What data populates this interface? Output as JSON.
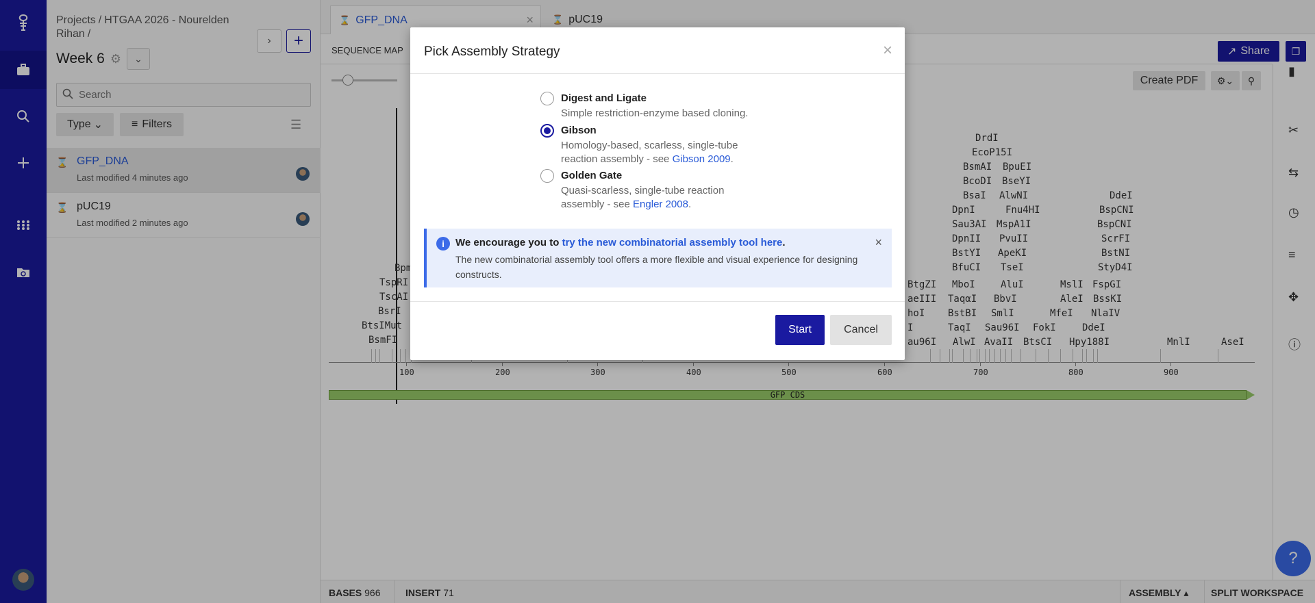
{
  "nav": {
    "items": [
      {
        "icon": "logo-icon"
      },
      {
        "icon": "briefcase-icon"
      },
      {
        "icon": "search-icon"
      },
      {
        "icon": "plus-icon"
      },
      {
        "icon": "apps-grid-icon"
      },
      {
        "icon": "folder-sync-icon"
      }
    ]
  },
  "sidebar": {
    "breadcrumb": [
      "Projects",
      "HTGAA 2026 - Nourelden Rihan"
    ],
    "folder_title": "Week 6",
    "search_placeholder": "Search",
    "type_label": "Type",
    "filters_label": "Filters",
    "items": [
      {
        "name": "GFP_DNA",
        "modified": "Last modified 4 minutes ago"
      },
      {
        "name": "pUC19",
        "modified": "Last modified 2 minutes ago"
      }
    ]
  },
  "tabs": [
    {
      "label": "GFP_DNA"
    },
    {
      "label": "pUC19"
    }
  ],
  "main": {
    "view_label": "SEQUENCE MAP",
    "share_label": "Share",
    "create_pdf_label": "Create PDF",
    "feature_label": "GFP CDS",
    "ticks": [
      "100",
      "200",
      "300",
      "400",
      "500",
      "600",
      "700",
      "800",
      "900"
    ],
    "enzymes_left": [
      "Bpm",
      "TspRI",
      "TscAI",
      "BsrI",
      "BtsIMut",
      "BsmFI"
    ],
    "enzymes_mid1": [
      "BtgZI",
      "aeIII",
      "hoI",
      "I",
      "au96I"
    ],
    "enzymes_mid2": [
      "DrdI",
      "EcoP15I",
      "BsmAI",
      "BcoDI",
      "BsaI",
      "DpnI",
      "Sau3AI",
      "DpnII",
      "BstYI",
      "BfuCI",
      "MboI",
      "TaqαI",
      "BstBI",
      "TaqI",
      "AlwI"
    ],
    "enzymes_mid3": [
      "BpuEI",
      "BseYI",
      "AlwNI",
      "Fnu4HI",
      "MspA1I",
      "PvuII",
      "ApeKI",
      "TseI",
      "AluI",
      "BbvI",
      "SmlI",
      "Sau96I",
      "AvaII",
      "FokI",
      "BtsCI"
    ],
    "enzymes_right": [
      "DdeI",
      "BspCNI",
      "BspCNI",
      "ScrFI",
      "BstNI",
      "StyD4I",
      "MslI",
      "FspGI",
      "AleI",
      "BssKI",
      "MfeI",
      "NlaIV",
      "DdeI",
      "Hpy188I",
      "MnlI",
      "AseI"
    ]
  },
  "status": {
    "bases_label": "BASES",
    "bases_value": "966",
    "insert_label": "INSERT",
    "insert_value": "71",
    "assembly_label": "ASSEMBLY",
    "split_label": "SPLIT WORKSPACE"
  },
  "modal": {
    "title": "Pick Assembly Strategy",
    "options": [
      {
        "label": "Digest and Ligate",
        "desc": "Simple restriction-enzyme based cloning.",
        "selected": false
      },
      {
        "label": "Gibson",
        "desc": "Homology-based, scarless, single-tube reaction assembly - see ",
        "link": "Gibson 2009",
        "selected": true
      },
      {
        "label": "Golden Gate",
        "desc": "Quasi-scarless, single-tube reaction assembly - see ",
        "link": "Engler 2008",
        "selected": false
      }
    ],
    "banner_prefix": "We encourage you to ",
    "banner_link": "try the new combinatorial assembly tool here",
    "banner_body": "The new combinatorial assembly tool offers a more flexible and visual experience for designing constructs.",
    "start_label": "Start",
    "cancel_label": "Cancel"
  },
  "colors": {
    "brand": "#1a1aa0",
    "link": "#2a5bd7",
    "feature": "#9acd6a"
  }
}
